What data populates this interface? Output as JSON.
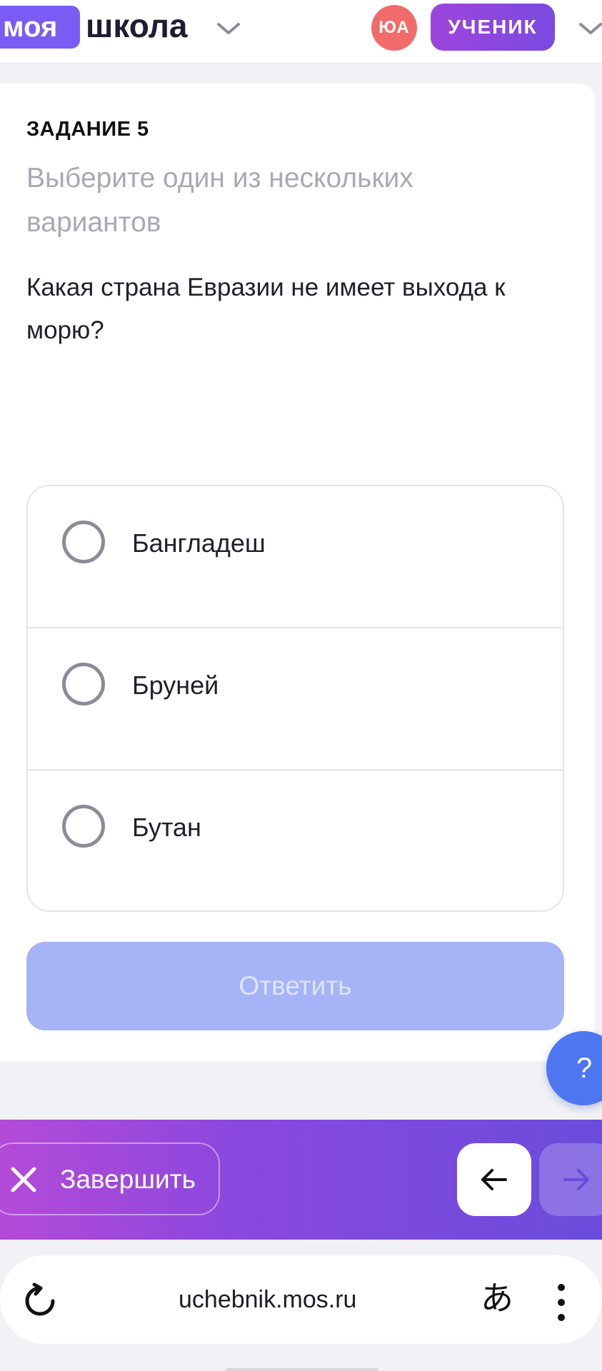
{
  "header": {
    "logo_part1": "моя",
    "logo_part2": "школа",
    "avatar_initials": "ЮА",
    "role_label": "УЧЕНИК"
  },
  "task": {
    "number_label": "ЗАДАНИЕ 5",
    "instruction": "Выберите один из нескольких вариантов",
    "question": "Какая страна Евразии не имеет выхода к морю?",
    "options": [
      {
        "label": "Бангладеш",
        "selected": false
      },
      {
        "label": "Бруней",
        "selected": false
      },
      {
        "label": "Бутан",
        "selected": false
      }
    ],
    "submit_label": "Ответить",
    "submit_enabled": false
  },
  "help_label": "?",
  "actions": {
    "finish_label": "Завершить",
    "prev_icon": "arrow-left-icon",
    "next_icon": "arrow-right-icon"
  },
  "browser": {
    "url": "uchebnik.mos.ru",
    "translate_glyph": "あ"
  },
  "colors": {
    "brand": "#7a5cf5",
    "role_pill": "#9d45dc",
    "avatar": "#f26b6b",
    "submit_disabled": "#a4b4f7",
    "help": "#4e76f0",
    "action_bar_start": "#b44ad8",
    "action_bar_end": "#6a4cdc"
  }
}
